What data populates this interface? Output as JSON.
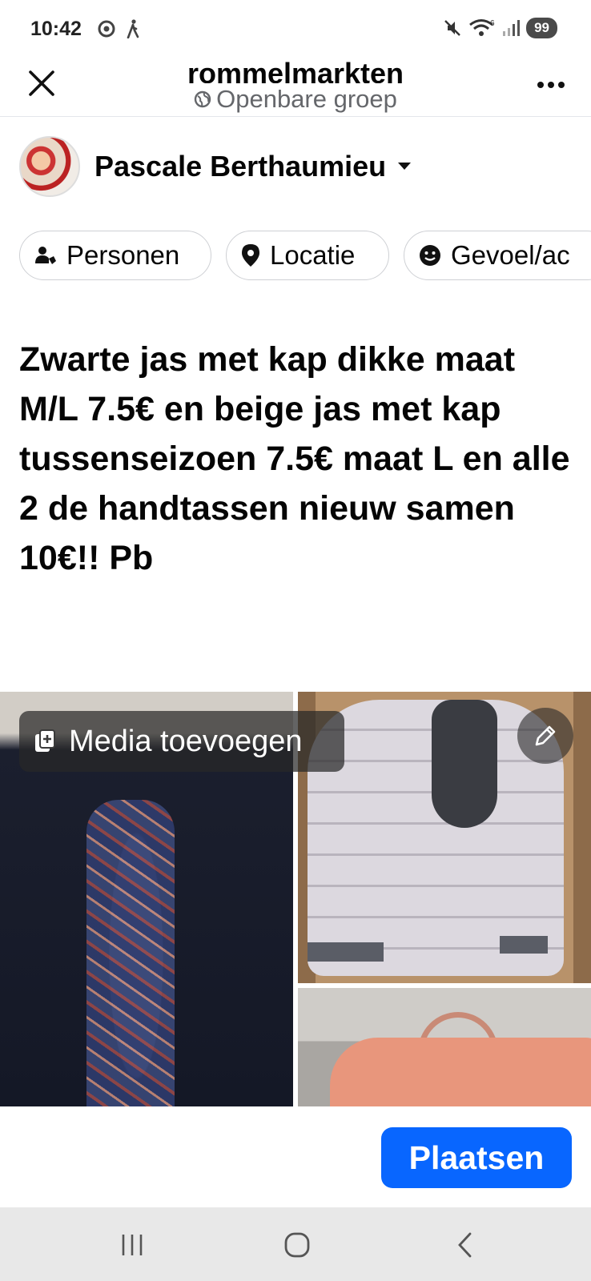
{
  "status_bar": {
    "time": "10:42",
    "battery": "99",
    "icons": [
      "chrome-icon",
      "walk-icon",
      "mute-icon",
      "wifi-icon",
      "signal-icon"
    ]
  },
  "header": {
    "title": "rommelmarkten",
    "subtitle": "Openbare groep",
    "icons": [
      "close-icon",
      "globe-icon",
      "more-icon"
    ]
  },
  "author": {
    "name": "Pascale Berthaumieu"
  },
  "chips": [
    {
      "label": "Personen",
      "icon": "tag-people-icon"
    },
    {
      "label": "Locatie",
      "icon": "location-pin-icon"
    },
    {
      "label": "Gevoel/ac",
      "icon": "smiley-icon"
    }
  ],
  "post": {
    "text": "Zwarte jas met kap dikke maat M/L 7.5€ en beige jas met kap tussenseizoen 7.5€ maat L en alle 2 de handtassen nieuw samen 10€!! Pb"
  },
  "media": {
    "add_label": "Media toevoegen"
  },
  "actions": {
    "post_label": "Plaatsen"
  },
  "colors": {
    "primary": "#0866ff",
    "text": "#050505",
    "muted": "#65676b",
    "nav_bg": "#e8e8e8"
  }
}
